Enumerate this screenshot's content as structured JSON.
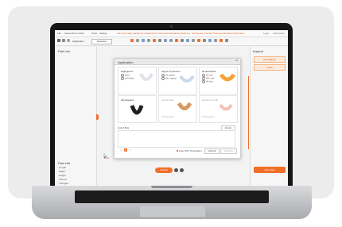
{
  "app": {
    "menu": [
      "File",
      "Sheet Prime Ortho",
      "Tools",
      "Setting"
    ],
    "title": "Lab Cinematic Appliance: Attachment Customized Retaining Mold On, Workspace: Dental Professional Station Ultra Enhancement",
    "right_menu": [
      "Login",
      "Full screen"
    ],
    "toolbar": {
      "app_label": "Application",
      "select_button": "Deselect"
    }
  },
  "left_panel": {
    "title": "Part List",
    "info_title": "Part Info",
    "info_rows": [
      "Length",
      "Width",
      "Height",
      "Volume",
      "Triangles"
    ]
  },
  "right_panel": {
    "title": "Inspect",
    "buttons": [
      "Re-Analyze",
      "Undo"
    ],
    "next_button": "Next step"
  },
  "canvas": {
    "main_button": "Cancel"
  },
  "dialog": {
    "title": "Application",
    "sections": {
      "nightguard": {
        "label": "Nightguard",
        "options": [
          "Hard",
          "Soft-Hard"
        ]
      },
      "aligner": {
        "label": "Aligner Protection",
        "options": [
          "All support",
          "Ref. support"
        ]
      },
      "dental_model": {
        "label": "Dental Model",
        "options": [
          "All vent",
          "Ref. vent",
          "All vent"
        ]
      },
      "mouthguard": {
        "label": "Mouthguard"
      },
      "model_base": {
        "label": "Model Base",
        "sub": "Coming Soon"
      },
      "retainer": {
        "label": "Retainer Guide",
        "sub": "Coming Soon"
      }
    },
    "list_label": "List of files",
    "list_button": "Import",
    "pager": [
      "<",
      "1",
      ">"
    ],
    "checkbox_label": "Auto Print Orientation",
    "cancel": "Cancel",
    "confirm": "Confirm"
  },
  "colors": {
    "accent": "#f0702a",
    "dialog_bg": "#ffffff",
    "panel_bg": "#f6f6f6"
  }
}
